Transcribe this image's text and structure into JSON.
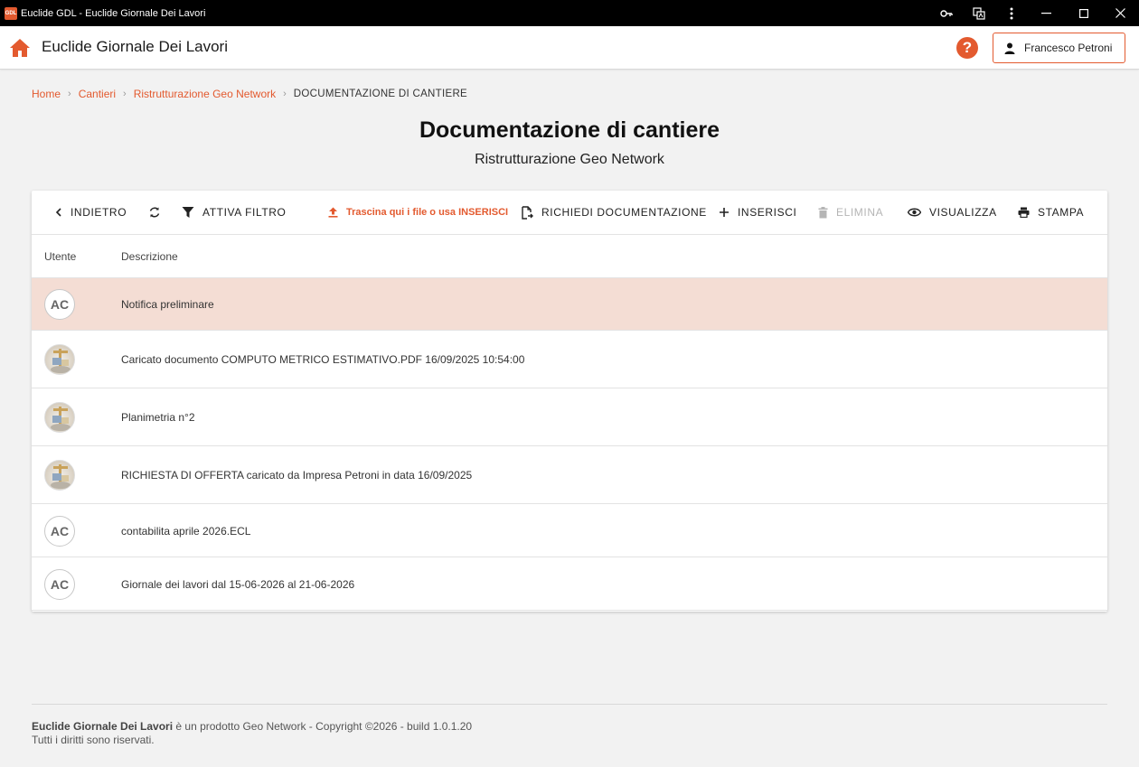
{
  "window": {
    "logo_text": "GDL",
    "title": "Euclide GDL - Euclide Giornale Dei Lavori"
  },
  "header": {
    "app_title": "Euclide Giornale Dei Lavori",
    "help_glyph": "?",
    "user_name": "Francesco Petroni"
  },
  "breadcrumb": {
    "items": [
      "Home",
      "Cantieri",
      "Ristrutturazione Geo Network"
    ],
    "current": "DOCUMENTAZIONE DI CANTIERE",
    "separator": "›"
  },
  "page": {
    "title": "Documentazione di cantiere",
    "subtitle": "Ristrutturazione Geo Network"
  },
  "toolbar": {
    "back": "INDIETRO",
    "filter": "ATTIVA FILTRO",
    "upload": "Trascina qui i file o usa INSERISCI",
    "request": "RICHIEDI DOCUMENTAZIONE",
    "insert": "INSERISCI",
    "delete": "ELIMINA",
    "view": "VISUALIZZA",
    "print": "STAMPA"
  },
  "table": {
    "columns": [
      "Utente",
      "Descrizione"
    ],
    "rows": [
      {
        "avatar": "AC",
        "avatar_type": "initials",
        "description": "Notifica preliminare",
        "selected": true
      },
      {
        "avatar": "",
        "avatar_type": "photo",
        "description": "Caricato documento COMPUTO METRICO ESTIMATIVO.PDF 16/09/2025 10:54:00",
        "selected": false
      },
      {
        "avatar": "",
        "avatar_type": "photo",
        "description": "Planimetria n°2",
        "selected": false
      },
      {
        "avatar": "",
        "avatar_type": "photo",
        "description": "RICHIESTA DI OFFERTA caricato da Impresa Petroni in data 16/09/2025",
        "selected": false
      },
      {
        "avatar": "AC",
        "avatar_type": "initials",
        "description": "contabilita aprile 2026.ECL",
        "selected": false
      },
      {
        "avatar": "AC",
        "avatar_type": "initials",
        "description": "Giornale dei lavori dal 15-06-2026 al 21-06-2026",
        "selected": false
      }
    ]
  },
  "footer": {
    "product": "Euclide Giornale Dei Lavori",
    "text": "è un prodotto Geo Network - Copyright ©2026 - build 1.0.1.20",
    "rights": "Tutti i diritti sono riservati."
  },
  "colors": {
    "accent": "#e35a2f",
    "selected_row": "#f4ddd4",
    "titlebar": "#000000"
  }
}
